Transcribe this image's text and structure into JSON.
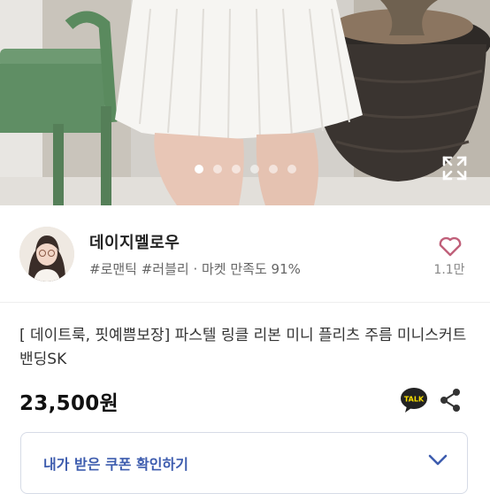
{
  "carousel": {
    "slide_count": 6,
    "active_index": 0,
    "expand_icon": "expand-icon"
  },
  "shop": {
    "name": "데이지멜로우",
    "tags": "#로맨틱 #러블리 · 마켓 만족도 91%",
    "like_count": "1.1만",
    "like_icon": "heart-outline-icon"
  },
  "product": {
    "title": "[ 데이트룩, 핏예쁨보장] 파스텔 링클 리본 미니 플리츠 주름 미니스커트 밴딩SK",
    "price": "23,500원"
  },
  "actions": {
    "talk_label": "TALK",
    "share_icon": "share-icon"
  },
  "coupon": {
    "label": "내가 받은 쿠폰 확인하기",
    "icon": "chevron-down-icon"
  },
  "colors": {
    "accent": "#3d5cae",
    "heart": "#c0607a",
    "talk_bg": "#222222",
    "talk_yellow": "#f9e000"
  }
}
